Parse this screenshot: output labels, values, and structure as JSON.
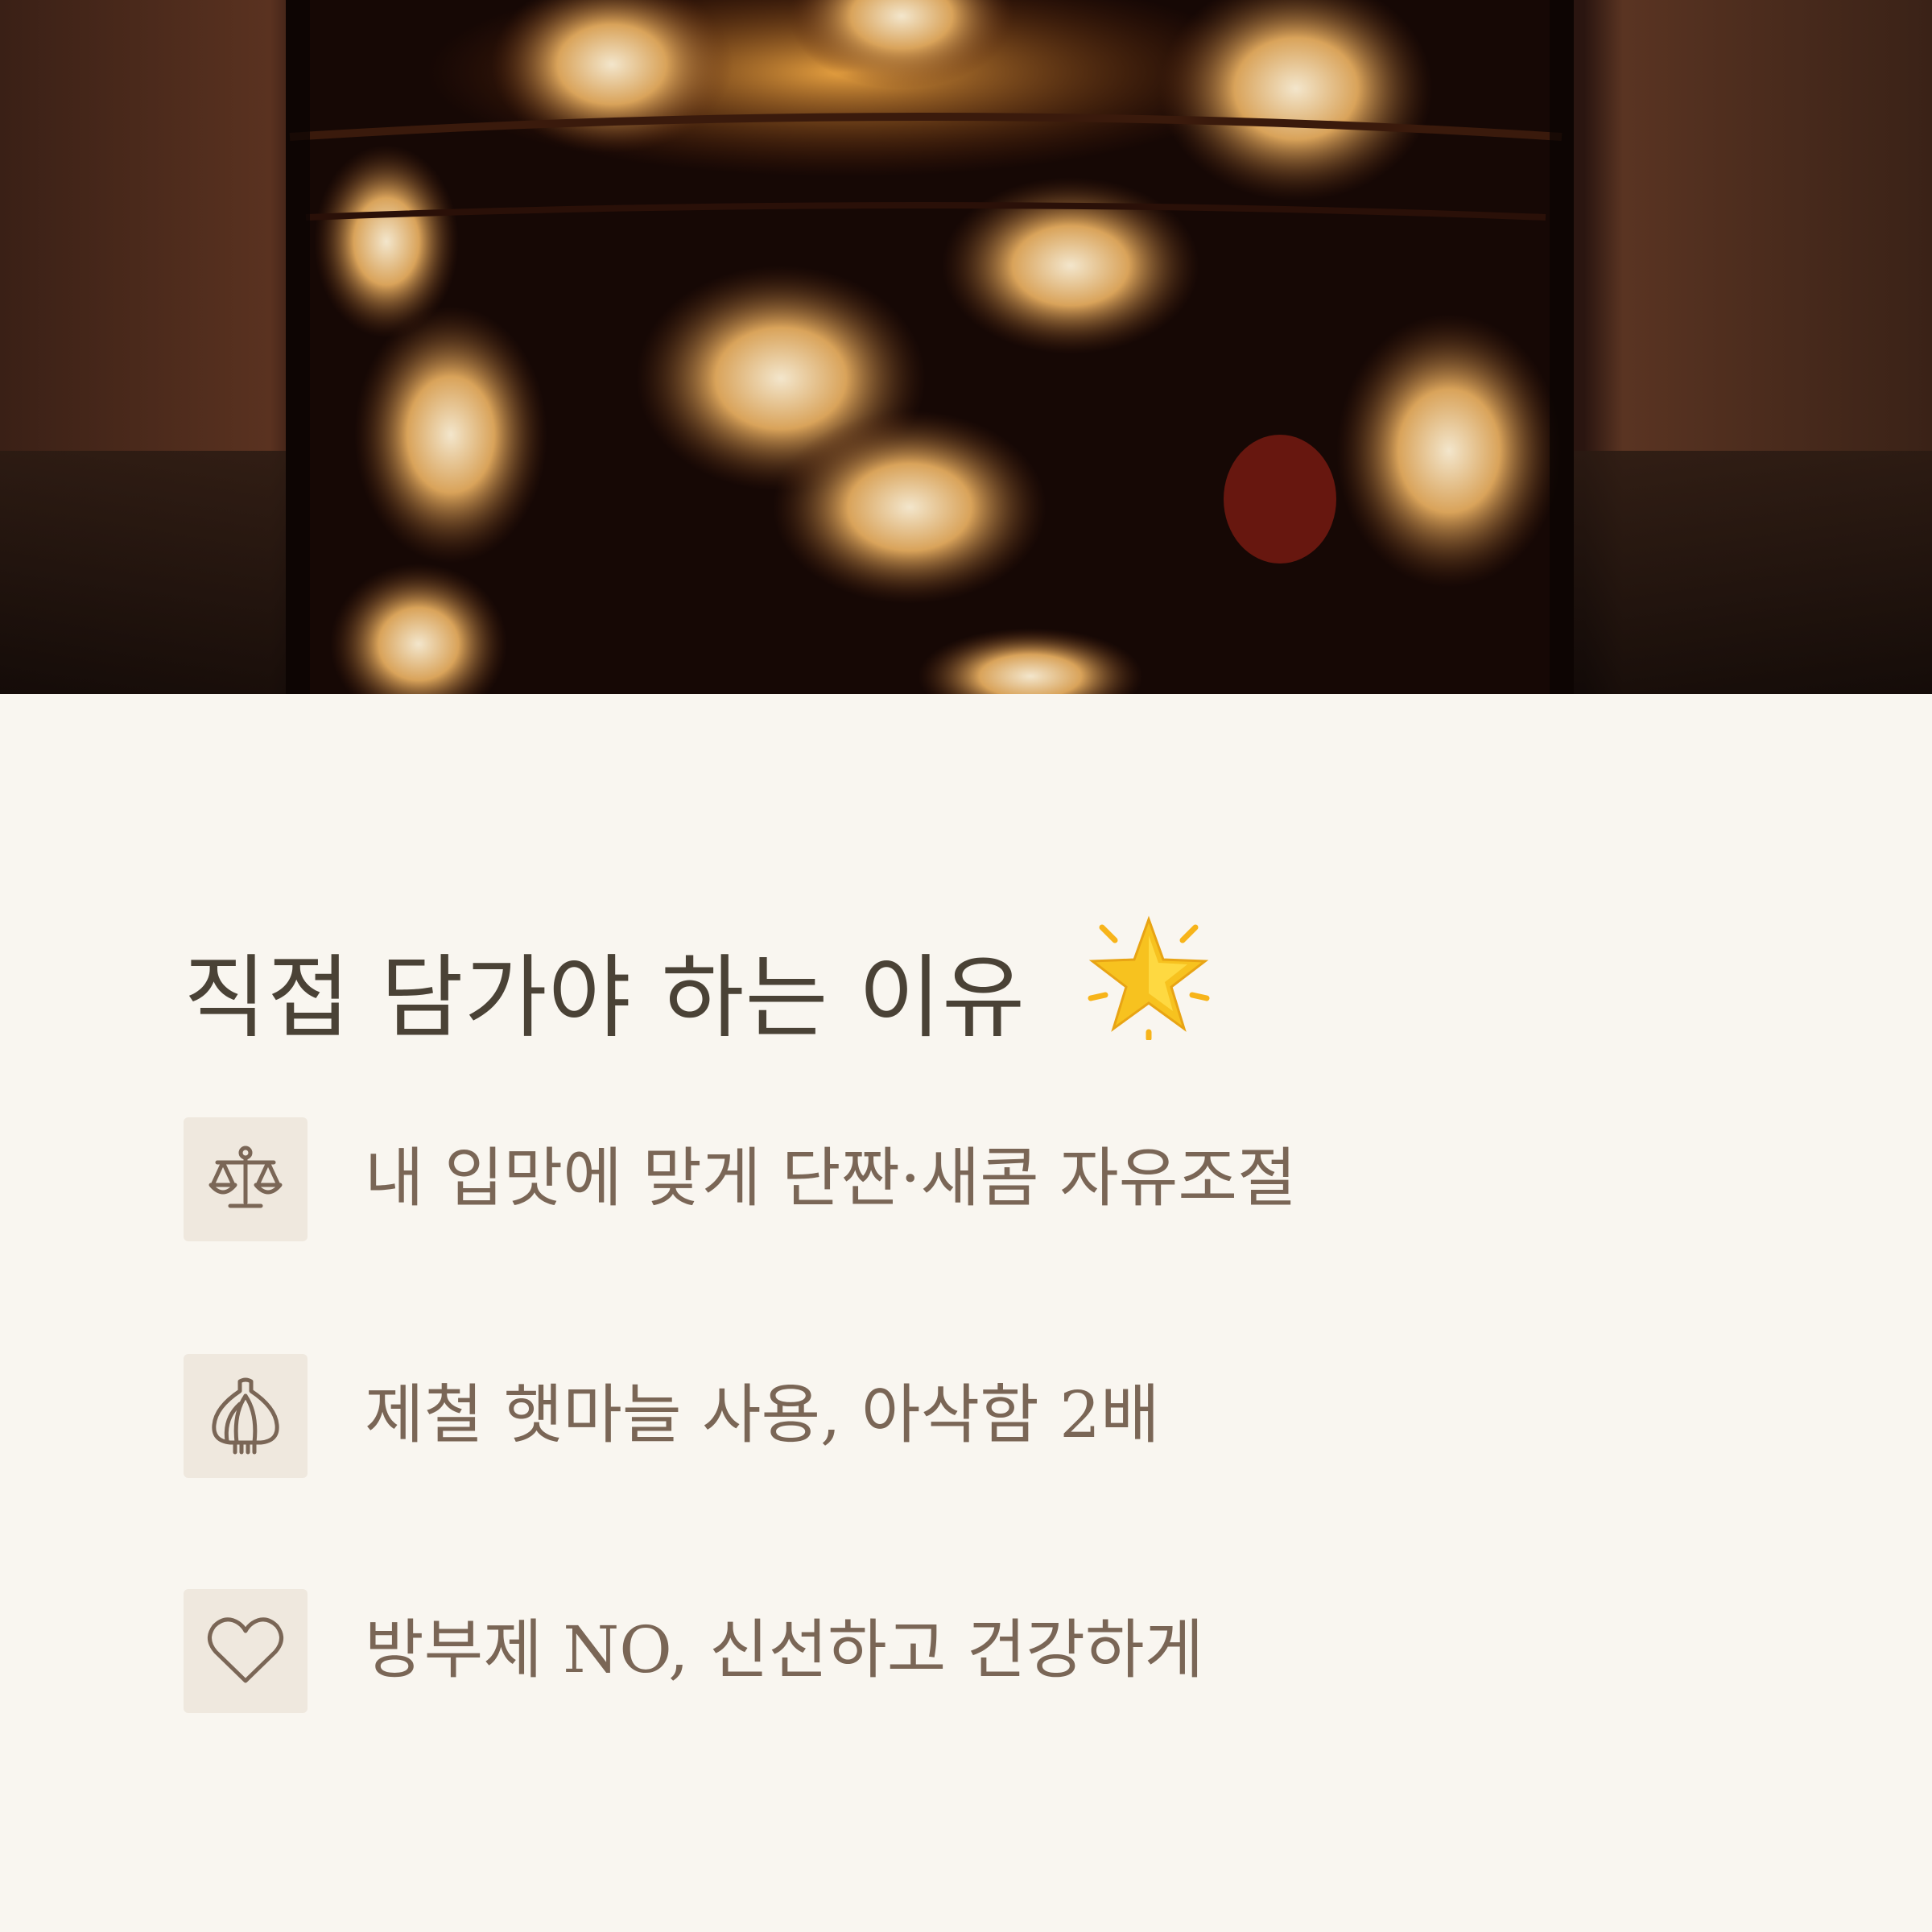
{
  "hero": {
    "subject": "pickled-garlic-jar-photo"
  },
  "title": {
    "text": "직접 담가야 하는 이유",
    "icon": "glowing-star-icon"
  },
  "reasons": [
    {
      "icon": "balance-scale-icon",
      "text": "내 입맛에 맞게 단짠·새콤 자유조절"
    },
    {
      "icon": "garlic-icon",
      "text": "제철 햇마늘 사용, 아삭함 2배"
    },
    {
      "icon": "heart-icon",
      "text": "방부제 NO, 신선하고 건강하게"
    }
  ],
  "colors": {
    "background": "#f9f6f0",
    "title": "#4a4236",
    "body_text": "#7a6656",
    "icon_tile": "#efe8de",
    "icon_stroke": "#7a6656"
  }
}
